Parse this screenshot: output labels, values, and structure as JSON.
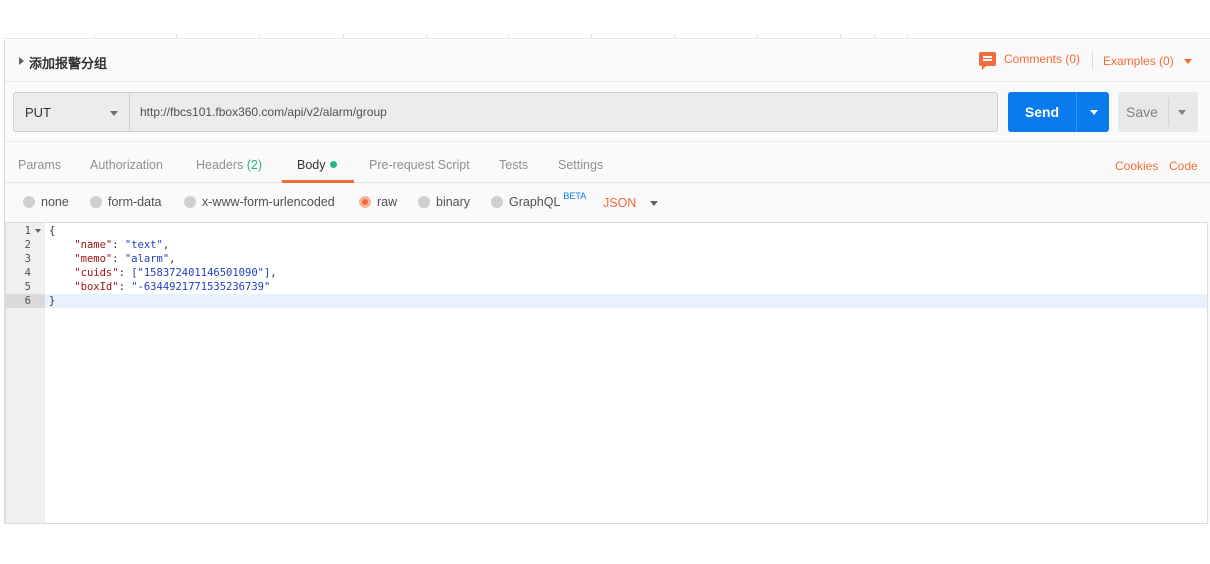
{
  "request": {
    "name": "添加报警分组",
    "comments_label": "Comments (0)",
    "examples_label": "Examples (0)"
  },
  "url_bar": {
    "method": "PUT",
    "url": "http://fbcs101.fbox360.com/api/v2/alarm/group",
    "send_label": "Send",
    "save_label": "Save"
  },
  "tabs": {
    "params": "Params",
    "authorization": "Authorization",
    "headers": "Headers",
    "headers_count": "(2)",
    "body": "Body",
    "pre_request": "Pre-request Script",
    "tests": "Tests",
    "settings": "Settings",
    "active": "Body",
    "cookies": "Cookies",
    "code": "Code"
  },
  "body_modes": {
    "none": "none",
    "form_data": "form-data",
    "urlencoded": "x-www-form-urlencoded",
    "raw": "raw",
    "binary": "binary",
    "graphql": "GraphQL",
    "graphql_badge": "BETA",
    "selected": "raw",
    "format": "JSON"
  },
  "editor": {
    "line_numbers": [
      "1",
      "2",
      "3",
      "4",
      "5",
      "6"
    ],
    "active_line": "6",
    "brace_open": "{",
    "brace_close": "}",
    "fields": [
      {
        "key": "\"name\"",
        "value": "\"text\""
      },
      {
        "key": "\"memo\"",
        "value": "\"alarm\""
      },
      {
        "key": "\"cuids\"",
        "value": "[\"158372401146501090\"]"
      },
      {
        "key": "\"boxId\"",
        "value": "\"-6344921771535236739\""
      }
    ]
  },
  "colors": {
    "accent": "#f26b3a",
    "send_blue": "#097bed",
    "status_green": "#26b47f"
  },
  "icons": [
    "caret-right-icon",
    "comment-icon",
    "chevron-down-icon",
    "radio-icon",
    "fold-arrow-icon"
  ]
}
